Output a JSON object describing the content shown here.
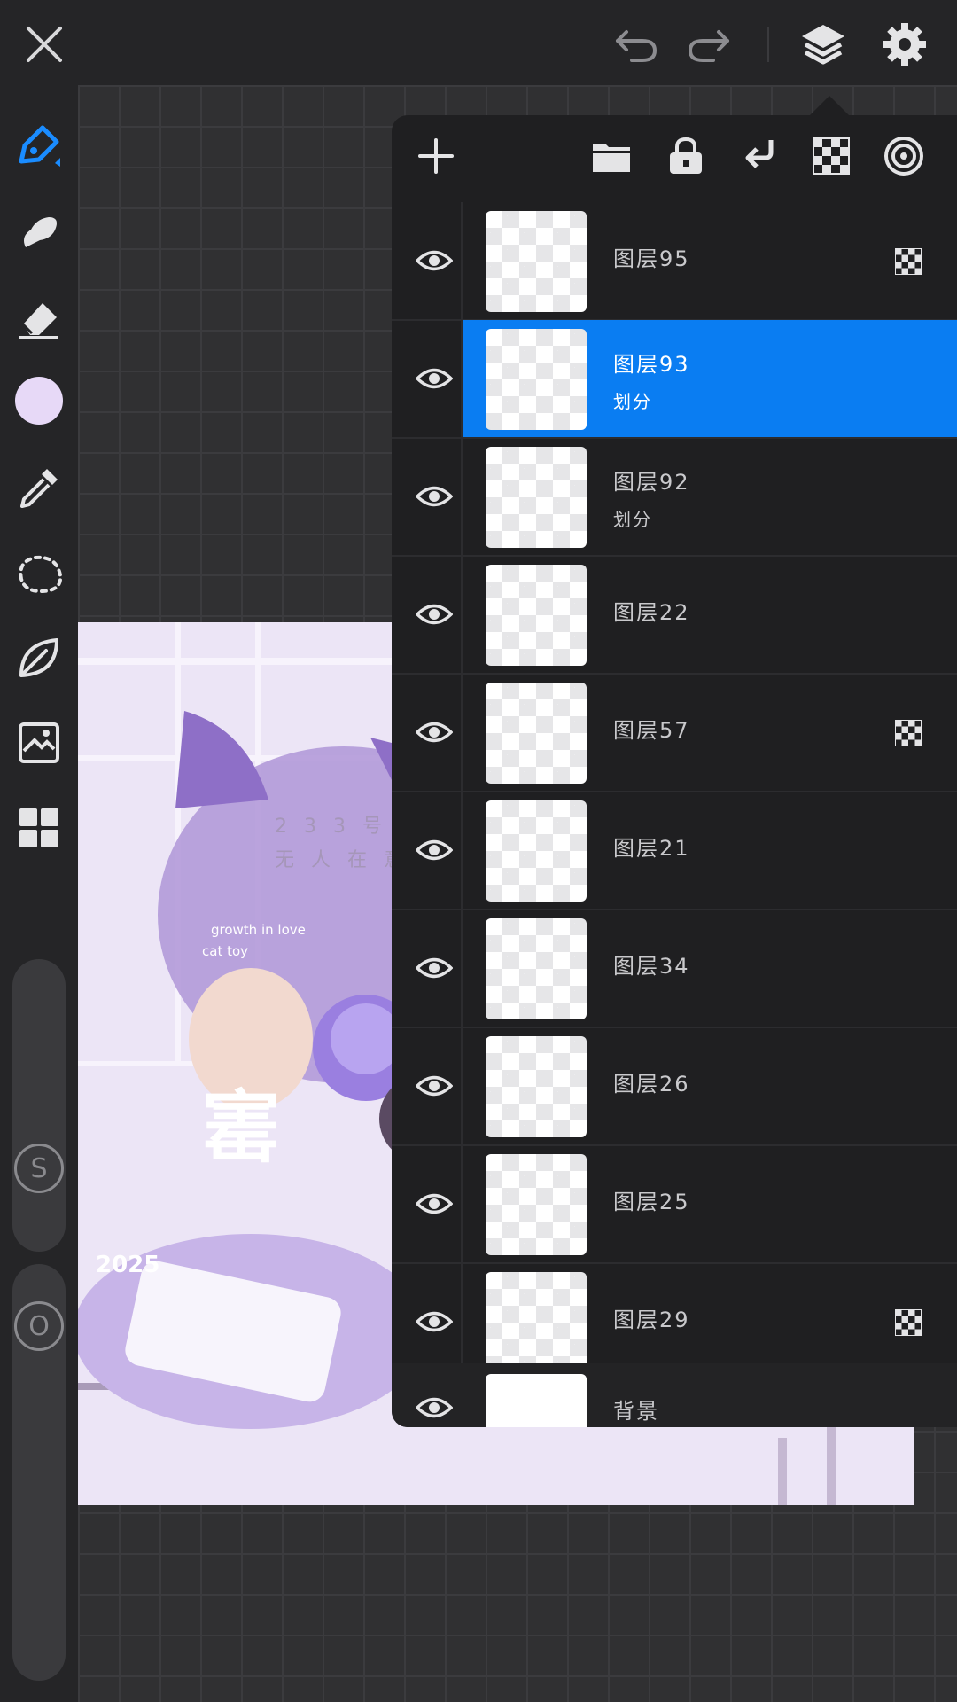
{
  "app": {
    "accent": "#0a7df2",
    "current_color": "#e7d9f7"
  },
  "topbar": {
    "icons": [
      "close-icon",
      "undo-icon",
      "redo-icon",
      "layers-icon",
      "settings-gear-icon"
    ]
  },
  "tools": [
    "pen-brush-icon",
    "smudge-icon",
    "eraser-icon",
    "color-swatch",
    "eyedropper-icon",
    "lasso-select-icon",
    "liquify-leaf-icon",
    "image-adjust-icon",
    "grid-gallery-icon"
  ],
  "side_sliders": {
    "size_label": "S",
    "opacity_label": "O"
  },
  "artwork": {
    "caption_cn1": "2 3 3 号",
    "caption_cn2": "无 人 在 意",
    "caption_en1": "growth in love",
    "caption_en2": "cat toy",
    "big_char": "寚",
    "small_text": "2025"
  },
  "layers_panel": {
    "toolbar_icons": [
      "add-icon",
      "folder-icon",
      "lock-icon",
      "merge-down-icon",
      "alpha-checker-icon",
      "mask-target-icon"
    ],
    "layers": [
      {
        "name": "图层95",
        "blend": "",
        "alpha_lock": true,
        "selected": false
      },
      {
        "name": "图层93",
        "blend": "划分",
        "alpha_lock": false,
        "selected": true
      },
      {
        "name": "图层92",
        "blend": "划分",
        "alpha_lock": false,
        "selected": false
      },
      {
        "name": "图层22",
        "blend": "",
        "alpha_lock": false,
        "selected": false
      },
      {
        "name": "图层57",
        "blend": "",
        "alpha_lock": true,
        "selected": false
      },
      {
        "name": "图层21",
        "blend": "",
        "alpha_lock": false,
        "selected": false
      },
      {
        "name": "图层34",
        "blend": "",
        "alpha_lock": false,
        "selected": false
      },
      {
        "name": "图层26",
        "blend": "",
        "alpha_lock": false,
        "selected": false
      },
      {
        "name": "图层25",
        "blend": "",
        "alpha_lock": false,
        "selected": false
      },
      {
        "name": "图层29",
        "blend": "",
        "alpha_lock": true,
        "selected": false
      }
    ],
    "background_layer": {
      "name": "背景"
    }
  }
}
